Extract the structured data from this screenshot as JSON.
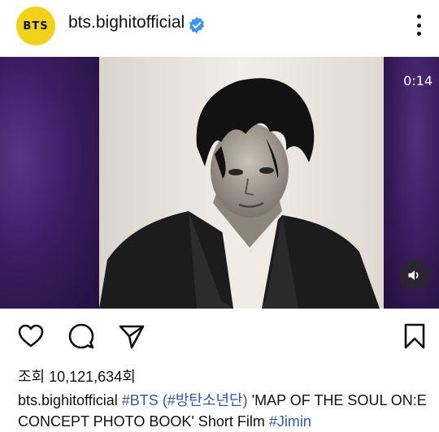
{
  "header": {
    "avatar_text": "BTS",
    "username": "bts.bighitofficial",
    "verified_icon": "verified-badge-icon",
    "more_icon": "more-vertical-icon"
  },
  "media": {
    "timer": "0:14",
    "sound_icon": "volume-on-icon"
  },
  "actions": {
    "like_icon": "heart-icon",
    "comment_icon": "comment-icon",
    "share_icon": "send-icon",
    "save_icon": "bookmark-icon"
  },
  "views": "조회 10,121,634회",
  "caption": {
    "username": "bts.bighitofficial",
    "tag1": "#BTS",
    "tag2": "(#방탄소년단)",
    "text": "'MAP OF THE SOUL ON:E CONCEPT PHOTO BOOK' Short Film",
    "tag3": "#Jimin"
  },
  "colors": {
    "avatar_bg": "#f2d21b",
    "verified": "#3897f0",
    "hashtag": "#2e5aa8",
    "purple_bg": "#3a1f5c"
  }
}
